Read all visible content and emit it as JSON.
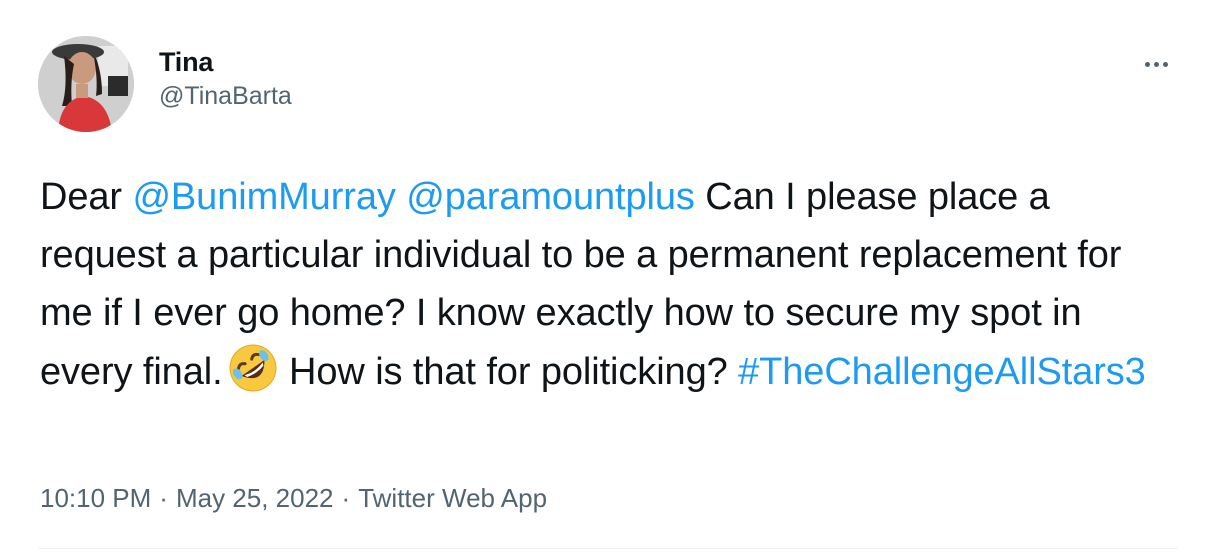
{
  "author": {
    "display_name": "Tina",
    "handle": "@TinaBarta"
  },
  "tweet": {
    "text_1": "Dear ",
    "mention_1": "@BunimMurray",
    "text_2": " ",
    "mention_2": "@paramountplus",
    "text_3": " Can I please place a request a particular individual to be a permanent replacement for me if I ever go home?  I know exactly how to secure my spot in every final.",
    "text_4": " How is that for politicking? ",
    "hashtag": "#TheChallengeAllStars3",
    "emoji": "rolling-on-floor-laughing"
  },
  "meta": {
    "time": "10:10 PM",
    "separator": "·",
    "date": "May 25, 2022",
    "source": "Twitter Web App"
  },
  "colors": {
    "link": "#1d9bf0",
    "text": "#0f1419",
    "secondary": "#536471"
  }
}
